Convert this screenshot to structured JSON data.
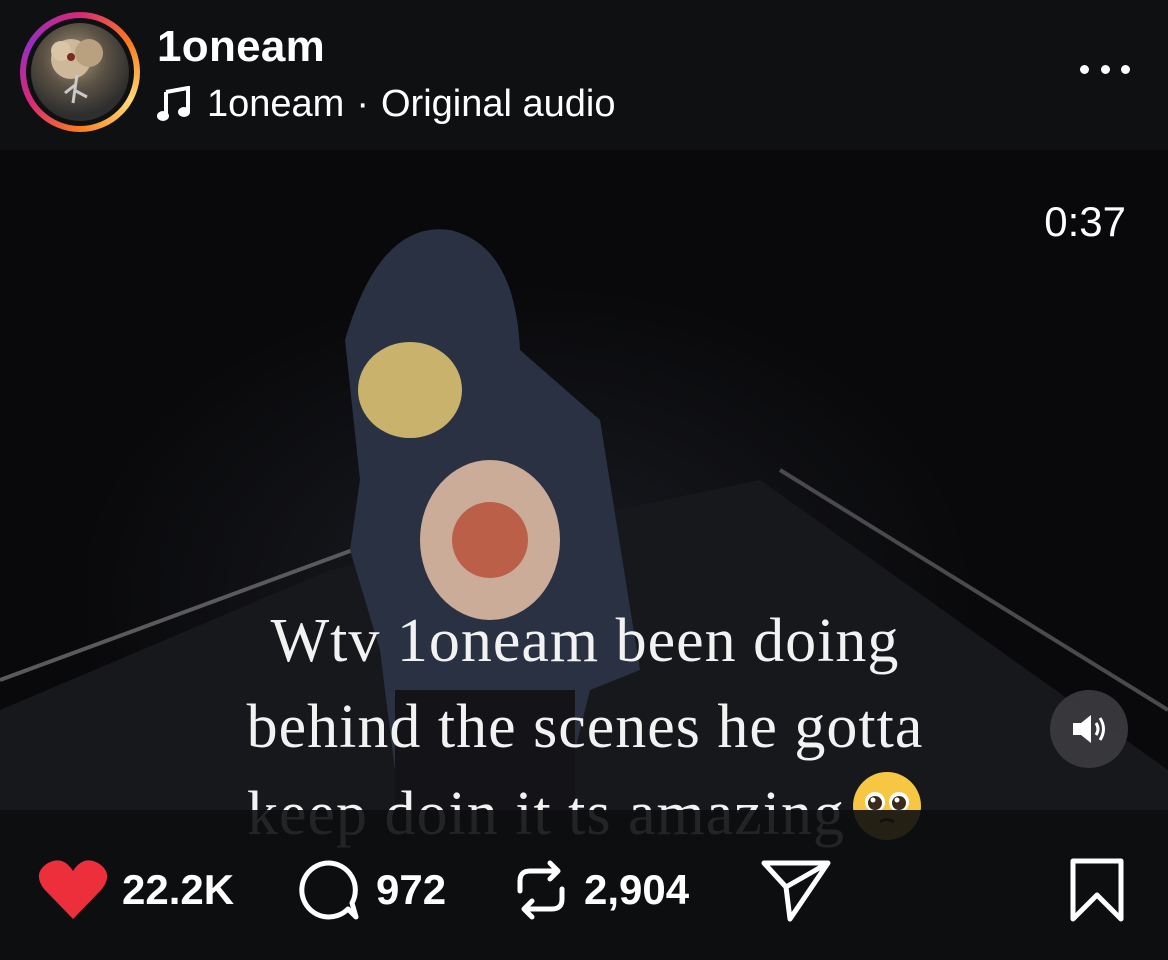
{
  "post": {
    "username": "1oneam",
    "audio_artist": "1oneam",
    "audio_separator": "·",
    "audio_title": "Original audio"
  },
  "video": {
    "duration": "0:37",
    "caption_line1": "Wtv 1oneam been doing",
    "caption_line2": "behind the scenes he gotta",
    "caption_line3": "keep doin it ts amazing",
    "caption_emoji": "pleading-face-emoji",
    "sound_icon": "speaker-icon"
  },
  "actions": {
    "likes": "22.2K",
    "comments": "972",
    "reposts": "2,904",
    "like_color": "#ed2f3b",
    "icons": [
      "heart-icon",
      "comment-icon",
      "repost-icon",
      "share-icon",
      "bookmark-icon"
    ]
  }
}
